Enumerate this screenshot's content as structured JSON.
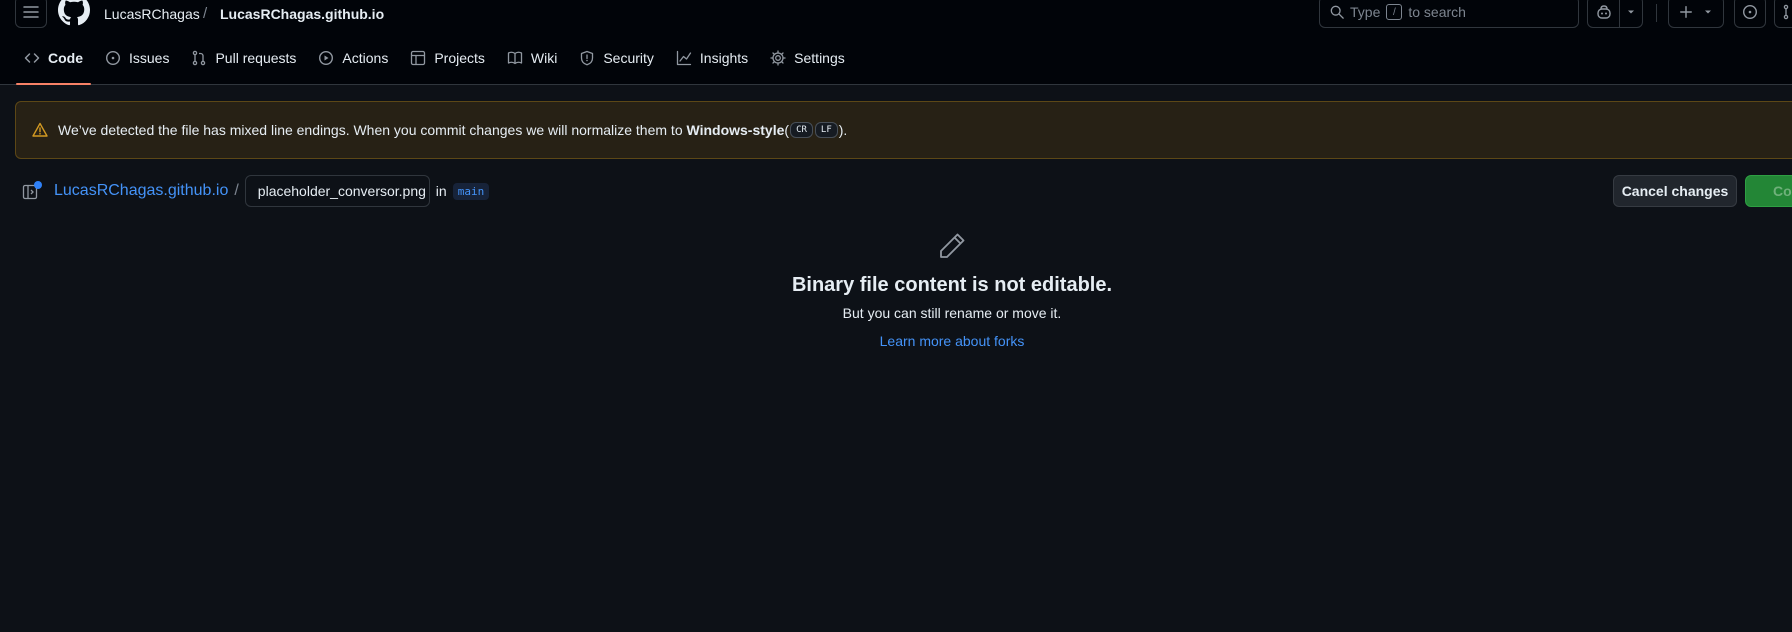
{
  "header": {
    "owner": "LucasRChagas",
    "separator": "/",
    "repo": "LucasRChagas.github.io",
    "search_prefix": "Type",
    "search_key": "/",
    "search_suffix": "to search"
  },
  "tabs": [
    {
      "label": "Code",
      "icon": "code-icon"
    },
    {
      "label": "Issues",
      "icon": "issue-icon"
    },
    {
      "label": "Pull requests",
      "icon": "pull-request-icon"
    },
    {
      "label": "Actions",
      "icon": "play-icon"
    },
    {
      "label": "Projects",
      "icon": "table-icon"
    },
    {
      "label": "Wiki",
      "icon": "book-icon"
    },
    {
      "label": "Security",
      "icon": "shield-icon"
    },
    {
      "label": "Insights",
      "icon": "graph-icon"
    },
    {
      "label": "Settings",
      "icon": "gear-icon"
    }
  ],
  "banner": {
    "text_before": "We’ve detected the file has mixed line endings. When you commit changes we will normalize them to",
    "style_label": "Windows-style",
    "open_paren": "(",
    "cr": "CR",
    "lf": "LF",
    "close": ")."
  },
  "editor": {
    "repo_link": "LucasRChagas.github.io",
    "slash": "/",
    "filename": "placeholder_conversor.png",
    "in_word": "in",
    "branch": "main",
    "cancel_label": "Cancel changes",
    "commit_label": "Commit changes..."
  },
  "empty_state": {
    "title": "Binary file content is not editable.",
    "subtitle": "But you can still rename or move it.",
    "link": "Learn more about forks"
  },
  "colors": {
    "background": "#0d1117",
    "header": "#010409",
    "accent_underline": "#f78166",
    "link": "#4493f8",
    "warning": "#d29922",
    "commit_green": "#238636"
  }
}
